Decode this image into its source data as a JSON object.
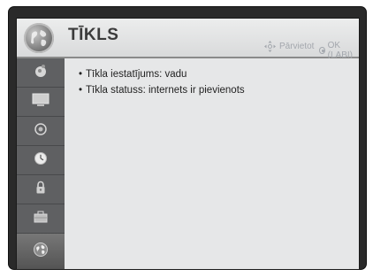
{
  "header": {
    "title": "TĪKLS",
    "hint_move": "Pārvietot",
    "hint_ok": "OK (LABI)"
  },
  "sidebar": {
    "items": [
      {
        "icon": "picture-icon"
      },
      {
        "icon": "monitor-icon"
      },
      {
        "icon": "audio-icon"
      },
      {
        "icon": "clock-icon"
      },
      {
        "icon": "lock-icon"
      },
      {
        "icon": "toolbox-icon"
      },
      {
        "icon": "network-globe-icon"
      }
    ],
    "active_index": 6
  },
  "content": {
    "lines": [
      "Tīkla iestatījums: vadu",
      "Tīkla statuss: internets ir pievienots"
    ]
  },
  "colors": {
    "header_bg": "#e3e4e5",
    "sidebar_bg": "#5f6062",
    "content_bg": "#e6e7e8",
    "hint_text": "#a3a7ad"
  }
}
